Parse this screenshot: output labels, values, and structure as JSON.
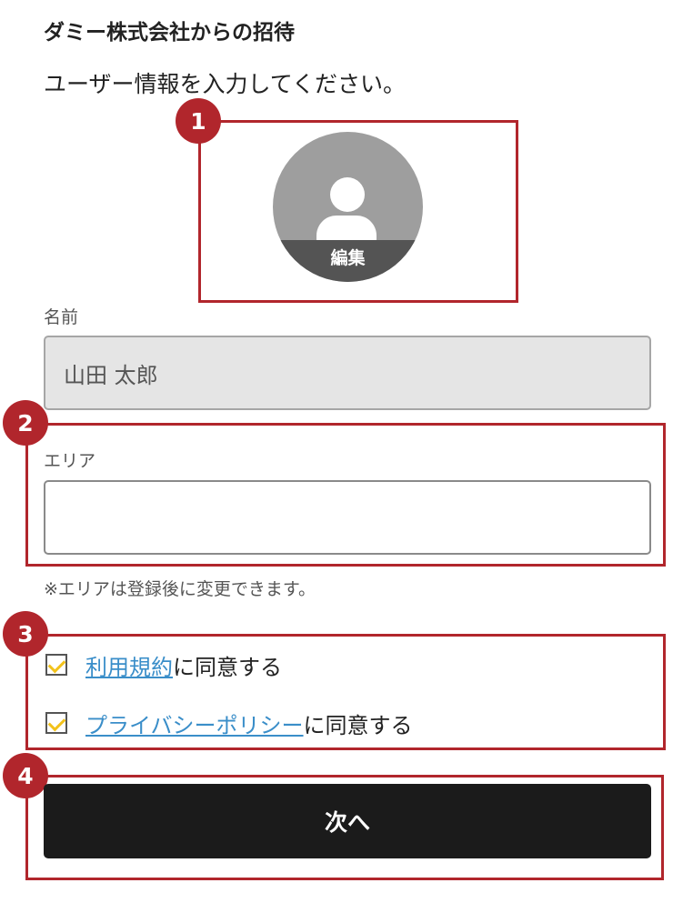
{
  "page": {
    "title": "ダミー株式会社からの招待",
    "subtitle": "ユーザー情報を入力してください。"
  },
  "avatar": {
    "edit_label": "編集"
  },
  "name_field": {
    "label": "名前",
    "value": "山田 太郎",
    "disabled": true
  },
  "area_field": {
    "label": "エリア",
    "value": "",
    "note": "※エリアは登録後に変更できます。"
  },
  "agreements": [
    {
      "link_text": "利用規約",
      "suffix": "に同意する",
      "checked": true
    },
    {
      "link_text": "プライバシーポリシー",
      "suffix": "に同意する",
      "checked": true
    }
  ],
  "submit": {
    "label": "次へ"
  },
  "annotations": {
    "markers": [
      "1",
      "2",
      "3",
      "4"
    ]
  },
  "colors": {
    "annotation_red": "#b1262c",
    "link_blue": "#3a8ec9",
    "check_yellow": "#f2c21b",
    "button_bg": "#1b1b1b",
    "avatar_gray": "#9e9e9e"
  }
}
